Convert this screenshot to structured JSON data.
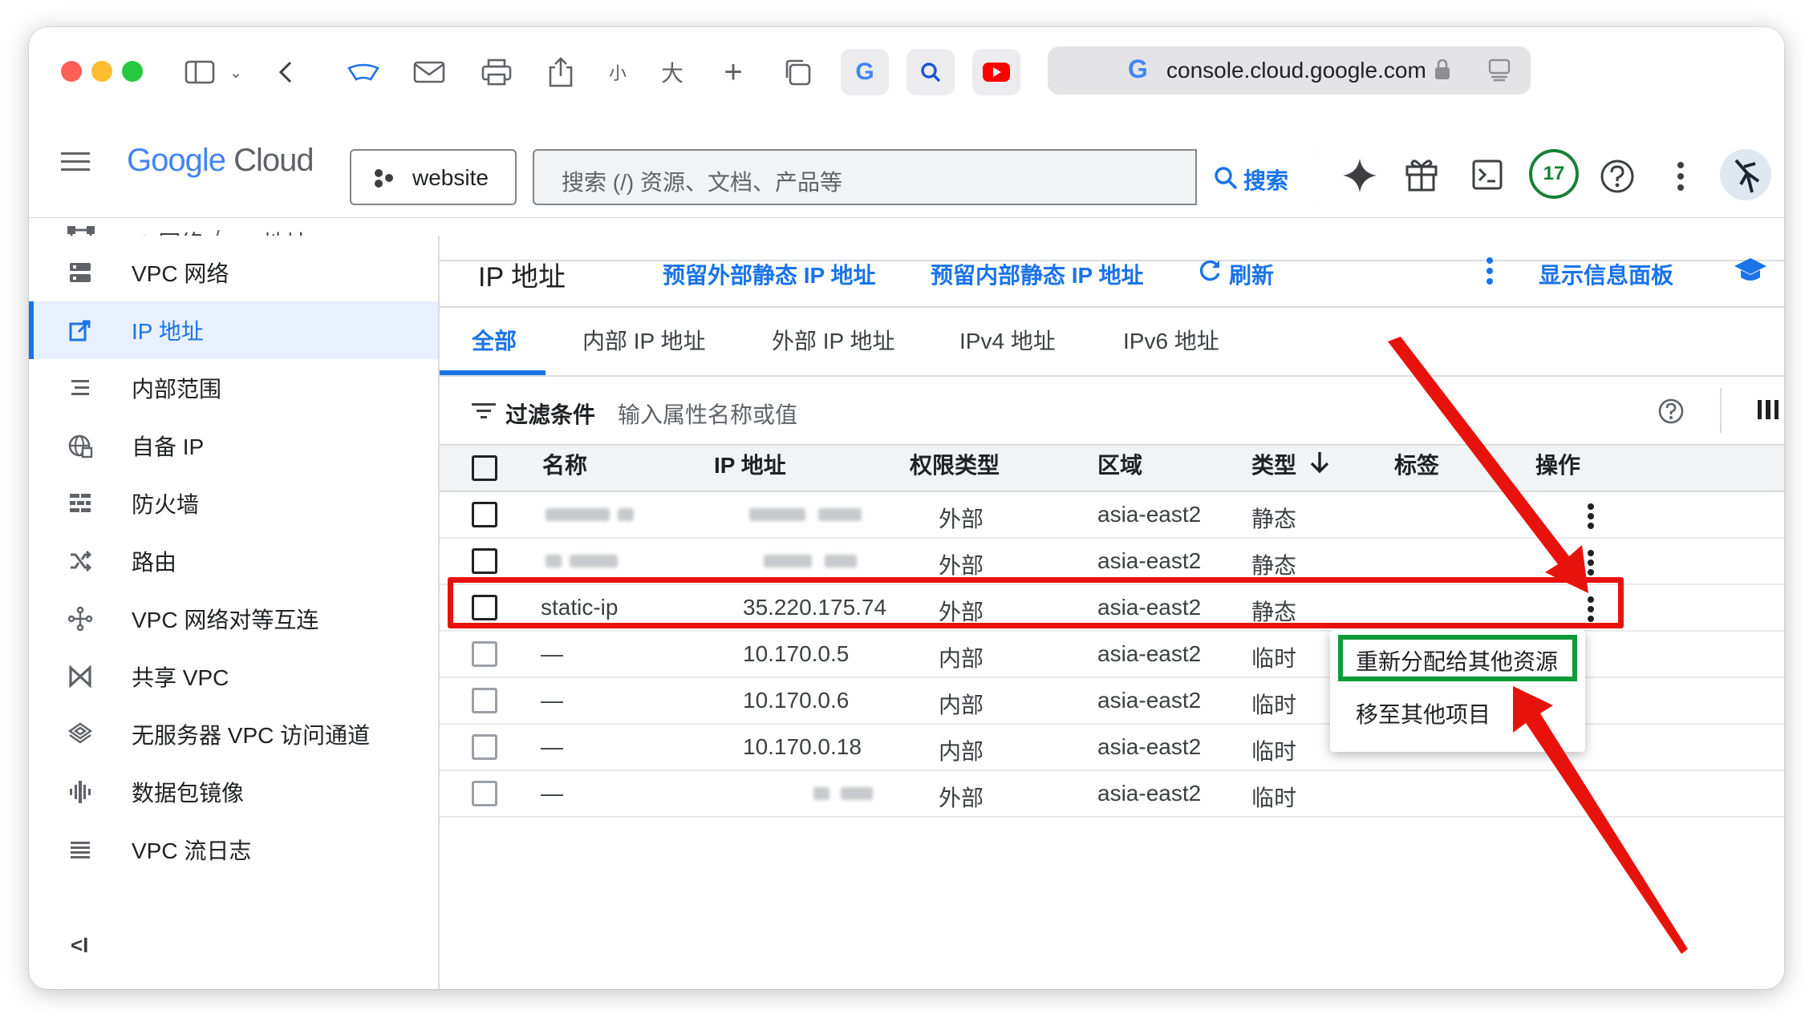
{
  "browser": {
    "font_small": "小",
    "font_large": "大",
    "url": "console.cloud.google.com",
    "traffic_colors": [
      "#ff5f57",
      "#febc2e",
      "#28c840"
    ]
  },
  "gcp": {
    "logo_google": "Google",
    "logo_cloud": "Cloud",
    "project": "website",
    "search_placeholder": "搜索 (/) 资源、文档、产品等",
    "search_button": "搜索",
    "notification_count": "17",
    "accent": "#1a73e8"
  },
  "breadcrumb": {
    "parent": "VPC 网络",
    "sep": "/",
    "current": "IP 地址"
  },
  "sidebar": {
    "items": [
      {
        "label": "VPC 网络",
        "icon": "vpc-network-icon"
      },
      {
        "label": "IP 地址",
        "icon": "ip-address-icon",
        "active": true
      },
      {
        "label": "内部范围",
        "icon": "internal-range-icon"
      },
      {
        "label": "自备 IP",
        "icon": "byoip-globe-icon"
      },
      {
        "label": "防火墙",
        "icon": "firewall-icon"
      },
      {
        "label": "路由",
        "icon": "routes-icon"
      },
      {
        "label": "VPC 网络对等互连",
        "icon": "peering-icon"
      },
      {
        "label": "共享 VPC",
        "icon": "shared-vpc-icon"
      },
      {
        "label": "无服务器 VPC 访问通道",
        "icon": "serverless-icon"
      },
      {
        "label": "数据包镜像",
        "icon": "packet-mirroring-icon"
      },
      {
        "label": "VPC 流日志",
        "icon": "flow-logs-icon"
      }
    ],
    "collapse": "<I"
  },
  "page": {
    "title": "IP 地址",
    "action_external": "预留外部静态 IP 地址",
    "action_internal": "预留内部静态 IP 地址",
    "action_refresh": "刷新",
    "action_info_panel": "显示信息面板"
  },
  "tabs": [
    "全部",
    "内部 IP 地址",
    "外部 IP 地址",
    "IPv4 地址",
    "IPv6 地址"
  ],
  "filter": {
    "label": "过滤条件",
    "placeholder": "输入属性名称或值"
  },
  "table": {
    "headers": [
      "名称",
      "IP 地址",
      "权限类型",
      "区域",
      "类型",
      "标签",
      "操作"
    ],
    "rows": [
      {
        "name": "",
        "ip": "",
        "access": "外部",
        "region": "asia-east2",
        "type": "静态"
      },
      {
        "name": "",
        "ip": "",
        "access": "外部",
        "region": "asia-east2",
        "type": "静态"
      },
      {
        "name": "static-ip",
        "ip": "35.220.175.74",
        "access": "外部",
        "region": "asia-east2",
        "type": "静态"
      },
      {
        "name": "—",
        "ip": "10.170.0.5",
        "access": "内部",
        "region": "asia-east2",
        "type": "临时"
      },
      {
        "name": "—",
        "ip": "10.170.0.6",
        "access": "内部",
        "region": "asia-east2",
        "type": "临时"
      },
      {
        "name": "—",
        "ip": "10.170.0.18",
        "access": "内部",
        "region": "asia-east2",
        "type": "临时"
      },
      {
        "name": "—",
        "ip": "",
        "access": "外部",
        "region": "asia-east2",
        "type": "临时"
      }
    ]
  },
  "menu": {
    "reassign": "重新分配给其他资源",
    "move": "移至其他项目"
  },
  "annotations": {
    "highlight_color": "#e8120c",
    "menu_highlight_color": "#0d9b3a"
  }
}
